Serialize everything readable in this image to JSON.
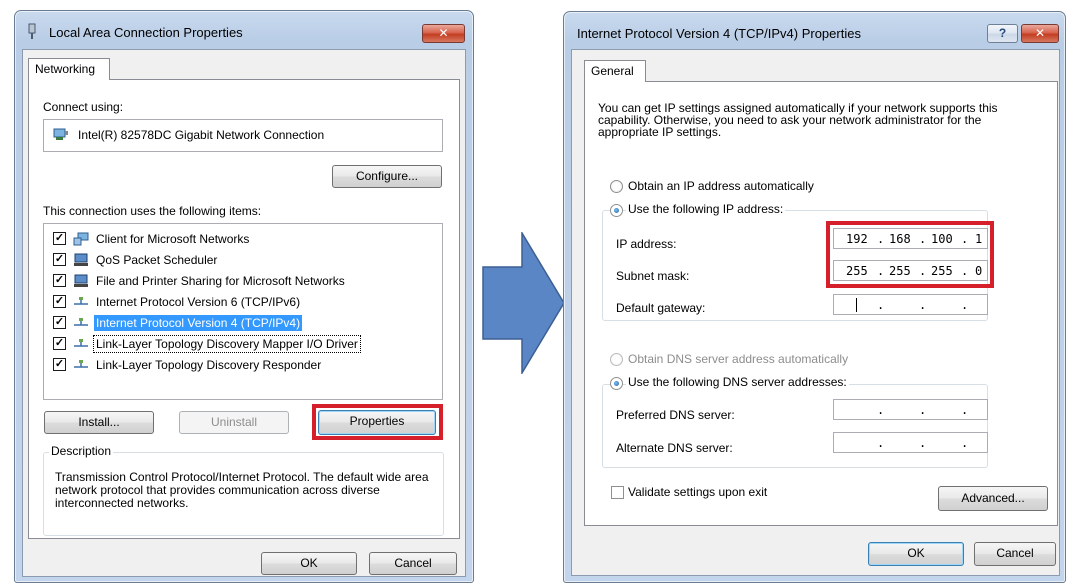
{
  "left_window": {
    "title": "Local Area Connection Properties",
    "close_glyph": "✕",
    "tab": "Networking",
    "connect_using_label": "Connect using:",
    "adapter_name": "Intel(R) 82578DC Gigabit Network Connection",
    "configure_button": "Configure...",
    "items_label": "This connection uses the following items:",
    "items": [
      {
        "label": "Client for Microsoft Networks",
        "checked": true,
        "icon": "network-client-icon",
        "selected": false
      },
      {
        "label": "QoS Packet Scheduler",
        "checked": true,
        "icon": "computer-service-icon",
        "selected": false
      },
      {
        "label": "File and Printer Sharing for Microsoft Networks",
        "checked": true,
        "icon": "computer-service-icon",
        "selected": false
      },
      {
        "label": "Internet Protocol Version 6 (TCP/IPv6)",
        "checked": true,
        "icon": "protocol-icon",
        "selected": false
      },
      {
        "label": "Internet Protocol Version 4 (TCP/IPv4)",
        "checked": true,
        "icon": "protocol-icon",
        "selected": true
      },
      {
        "label": "Link-Layer Topology Discovery Mapper I/O Driver",
        "checked": true,
        "icon": "protocol-icon",
        "selected": false,
        "focused": true
      },
      {
        "label": "Link-Layer Topology Discovery Responder",
        "checked": true,
        "icon": "protocol-icon",
        "selected": false
      }
    ],
    "install_button": "Install...",
    "uninstall_button": "Uninstall",
    "properties_button": "Properties",
    "description_legend": "Description",
    "description_text": "Transmission Control Protocol/Internet Protocol. The default wide area network protocol that provides communication across diverse interconnected networks.",
    "ok_button": "OK",
    "cancel_button": "Cancel"
  },
  "right_window": {
    "title": "Internet Protocol Version 4 (TCP/IPv4) Properties",
    "help_glyph": "?",
    "close_glyph": "✕",
    "tab": "General",
    "intro_text": "You can get IP settings assigned automatically if your network supports this capability. Otherwise, you need to ask your network administrator for the appropriate IP settings.",
    "obtain_ip_auto": "Obtain an IP address automatically",
    "use_following_ip": "Use the following IP address:",
    "ip_address_label": "IP address:",
    "ip_address_value": [
      "192",
      "168",
      "100",
      "1"
    ],
    "subnet_mask_label": "Subnet mask:",
    "subnet_mask_value": [
      "255",
      "255",
      "255",
      "0"
    ],
    "default_gateway_label": "Default gateway:",
    "obtain_dns_auto": "Obtain DNS server address automatically",
    "use_following_dns": "Use the following DNS server addresses:",
    "preferred_dns_label": "Preferred DNS server:",
    "alternate_dns_label": "Alternate DNS server:",
    "validate_label": "Validate settings upon exit",
    "advanced_button": "Advanced...",
    "ok_button": "OK",
    "cancel_button": "Cancel"
  },
  "colors": {
    "highlight": "#d5202c",
    "arrow_fill": "#5b86c5",
    "selection": "#3399ff"
  },
  "ip_separator": "."
}
